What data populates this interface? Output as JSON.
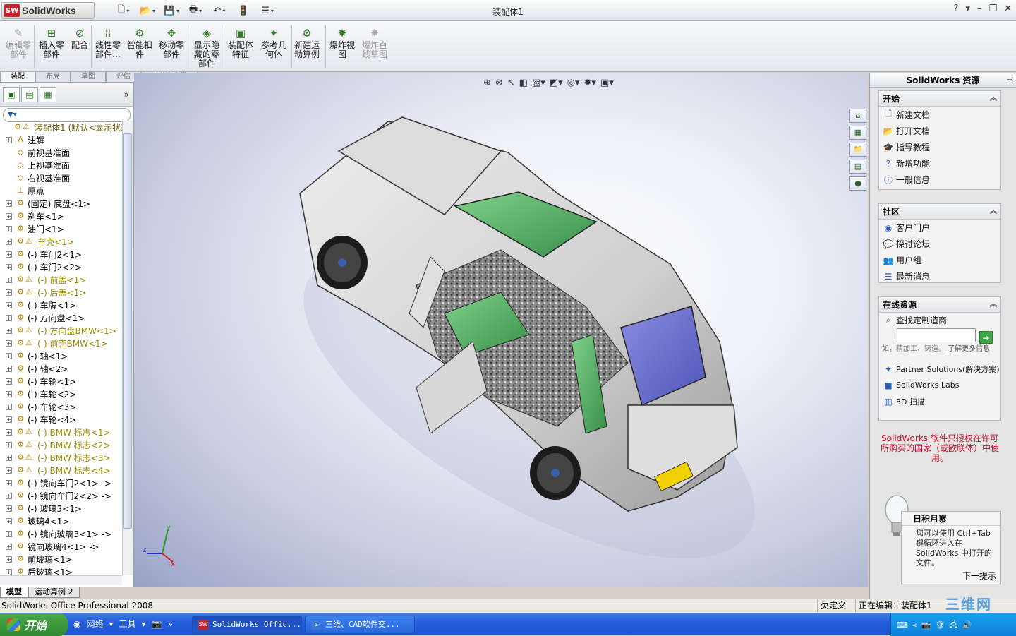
{
  "app": {
    "logo_badge": "SW",
    "logo_text": "SolidWorks",
    "doc_title": "装配体1",
    "window_controls": [
      "?",
      "▾",
      "–",
      "❐",
      "✕"
    ]
  },
  "ribbon": {
    "commands": [
      {
        "label": "编辑零\n部件",
        "icon": "edit-component-icon",
        "disabled": true
      },
      {
        "label": "插入零\n部件",
        "icon": "insert-component-icon",
        "disabled": false
      },
      {
        "label": "配合",
        "icon": "mate-icon",
        "disabled": false
      },
      {
        "label": "线性零\n部件…",
        "icon": "linear-pattern-icon",
        "disabled": false
      },
      {
        "label": "智能扣\n件",
        "icon": "smart-fastener-icon",
        "disabled": false
      },
      {
        "label": "移动零\n部件",
        "icon": "move-component-icon",
        "disabled": false
      },
      {
        "label": "显示隐\n藏的零\n部件",
        "icon": "show-hidden-icon",
        "disabled": false
      },
      {
        "label": "装配体\n特征",
        "icon": "assembly-feature-icon",
        "disabled": false
      },
      {
        "label": "参考几\n何体",
        "icon": "reference-geometry-icon",
        "disabled": false
      },
      {
        "label": "新建运\n动算例",
        "icon": "motion-study-icon",
        "disabled": false
      },
      {
        "label": "爆炸视\n图",
        "icon": "exploded-view-icon",
        "disabled": false
      },
      {
        "label": "爆炸直\n线草图",
        "icon": "explode-line-icon",
        "disabled": true
      }
    ],
    "tabs": [
      "装配",
      "布局",
      "草图",
      "评估",
      "办公室产品"
    ]
  },
  "tree": {
    "filter_icon": "filter-icon",
    "items": [
      {
        "label": "装配体1 (默认<显示状态",
        "pm": "",
        "warn": true,
        "root": true
      },
      {
        "label": "注解",
        "pm": "+",
        "warn": false
      },
      {
        "label": "前视基准面",
        "pm": "",
        "warn": false
      },
      {
        "label": "上视基准面",
        "pm": "",
        "warn": false
      },
      {
        "label": "右视基准面",
        "pm": "",
        "warn": false
      },
      {
        "label": "原点",
        "pm": "",
        "warn": false
      },
      {
        "label": "(固定) 底盘<1>",
        "pm": "+",
        "warn": false
      },
      {
        "label": "刹车<1>",
        "pm": "+",
        "warn": false
      },
      {
        "label": "油门<1>",
        "pm": "+",
        "warn": false
      },
      {
        "label": "车壳<1>",
        "pm": "+",
        "warn": true
      },
      {
        "label": "(-) 车门2<1>",
        "pm": "+",
        "warn": false
      },
      {
        "label": "(-) 车门2<2>",
        "pm": "+",
        "warn": false
      },
      {
        "label": "(-) 前盖<1>",
        "pm": "+",
        "warn": true
      },
      {
        "label": "(-) 后盖<1>",
        "pm": "+",
        "warn": true
      },
      {
        "label": "(-) 车牌<1>",
        "pm": "+",
        "warn": false
      },
      {
        "label": "(-) 方向盘<1>",
        "pm": "+",
        "warn": false
      },
      {
        "label": "(-) 方向盘BMW<1>",
        "pm": "+",
        "warn": true
      },
      {
        "label": "(-) 前壳BMW<1>",
        "pm": "+",
        "warn": true
      },
      {
        "label": "(-) 轴<1>",
        "pm": "+",
        "warn": false
      },
      {
        "label": "(-) 轴<2>",
        "pm": "+",
        "warn": false
      },
      {
        "label": "(-) 车轮<1>",
        "pm": "+",
        "warn": false
      },
      {
        "label": "(-) 车轮<2>",
        "pm": "+",
        "warn": false
      },
      {
        "label": "(-) 车轮<3>",
        "pm": "+",
        "warn": false
      },
      {
        "label": "(-) 车轮<4>",
        "pm": "+",
        "warn": false
      },
      {
        "label": "(-) BMW 标志<1>",
        "pm": "+",
        "warn": true
      },
      {
        "label": "(-) BMW 标志<2>",
        "pm": "+",
        "warn": true
      },
      {
        "label": "(-) BMW 标志<3>",
        "pm": "+",
        "warn": true
      },
      {
        "label": "(-) BMW 标志<4>",
        "pm": "+",
        "warn": true
      },
      {
        "label": "(-) 镜向车门2<1> ->",
        "pm": "+",
        "warn": false
      },
      {
        "label": "(-) 镜向车门2<2> ->",
        "pm": "+",
        "warn": false
      },
      {
        "label": "(-) 玻璃3<1>",
        "pm": "+",
        "warn": false
      },
      {
        "label": "玻璃4<1>",
        "pm": "+",
        "warn": false
      },
      {
        "label": "(-) 镜向玻璃3<1> ->",
        "pm": "+",
        "warn": false
      },
      {
        "label": "镜向玻璃4<1> ->",
        "pm": "+",
        "warn": false
      },
      {
        "label": "前玻璃<1>",
        "pm": "+",
        "warn": false
      },
      {
        "label": "后玻璃<1>",
        "pm": "+",
        "warn": false
      }
    ]
  },
  "bottom_tabs": [
    "模型",
    "运动算例 2"
  ],
  "right_panel": {
    "title": "SolidWorks 资源",
    "start": {
      "title": "开始",
      "links": [
        {
          "label": "新建文档",
          "icon": "new-doc-icon"
        },
        {
          "label": "打开文档",
          "icon": "open-folder-icon"
        },
        {
          "label": "指导教程",
          "icon": "tutorial-icon"
        },
        {
          "label": "新增功能",
          "icon": "help-question-icon"
        },
        {
          "label": "一般信息",
          "icon": "info-icon"
        }
      ]
    },
    "community": {
      "title": "社区",
      "links": [
        {
          "label": "客户门户",
          "icon": "portal-icon"
        },
        {
          "label": "探讨论坛",
          "icon": "forum-icon"
        },
        {
          "label": "用户组",
          "icon": "user-group-icon"
        },
        {
          "label": "最新消息",
          "icon": "rss-icon"
        }
      ]
    },
    "online": {
      "title": "在线资源",
      "search_label": "查找定制造商",
      "search_hint": "如，精加工、铸造。",
      "search_more": "了解更多信息",
      "links": [
        {
          "label": "Partner Solutions(解决方案)",
          "icon": "partner-icon"
        },
        {
          "label": "SolidWorks Labs",
          "icon": "labs-icon"
        },
        {
          "label": "3D 扫描",
          "icon": "scan-icon"
        }
      ]
    },
    "license_notice": "SolidWorks 软件只授权在许可所购买的国家（或欧联体）中使用。",
    "tip": {
      "title": "日积月累",
      "body": "您可以使用 Ctrl+Tab 键循环进入在 SolidWorks 中打开的文件。",
      "next": "下一提示"
    }
  },
  "status": {
    "left": "SolidWorks Office Professional 2008",
    "undefined": "欠定义",
    "editing": "正在编辑：装配体1",
    "watermark": "三维网"
  },
  "taskbar": {
    "start": "开始",
    "quick": [
      "网络",
      "工具"
    ],
    "tasks": [
      "SolidWorks Offic...",
      "三维、CAD软件交..."
    ]
  },
  "colors": {
    "accent": "#c8232c",
    "link_red": "#c8102e",
    "warn": "#9a8a00"
  }
}
